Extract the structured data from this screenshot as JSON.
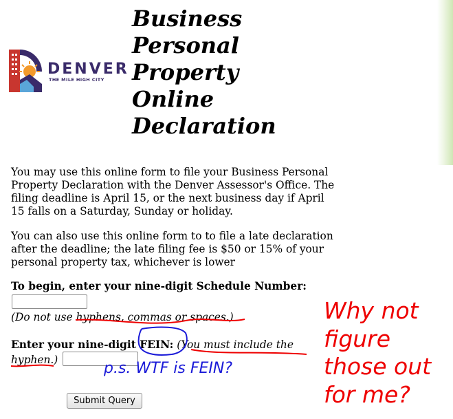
{
  "header": {
    "title_lines": [
      "Business",
      "Personal",
      "Property",
      "Online",
      "Declaration"
    ],
    "logo": {
      "word": "DENVER",
      "tagline": "THE MILE HIGH CITY"
    }
  },
  "intro": {
    "paragraph1": "You may use this online form to file your Business Personal Property Declaration with the Denver Assessor's Office. The filing deadline is April 15, or the next business day if April 15 falls on a Saturday, Sunday or holiday.",
    "paragraph2": "You can also use this online form to to file a late declaration after the deadline; the late filing fee is $50 or 15% of your personal property tax, whichever is lower"
  },
  "form": {
    "schedule_label": "To begin, enter your nine-digit Schedule Number:",
    "schedule_value": "",
    "schedule_note": "(Do not use hyphens, commas or spaces.)",
    "fein_label": "Enter your nine-digit FEIN:",
    "fein_note": "(You must include the hyphen.)",
    "fein_value": "",
    "submit_label": "Submit Query"
  },
  "annotations": {
    "red_note_lines": [
      "Why not",
      "figure",
      "those out",
      "for me?"
    ],
    "blue_note": "p.s. WTF is FEIN?",
    "colors": {
      "red": "#ee0000",
      "blue": "#1a1ad8"
    }
  },
  "colors": {
    "logo_purple": "#3a2b6a",
    "logo_red": "#c8362f",
    "logo_orange": "#f39a2b"
  }
}
